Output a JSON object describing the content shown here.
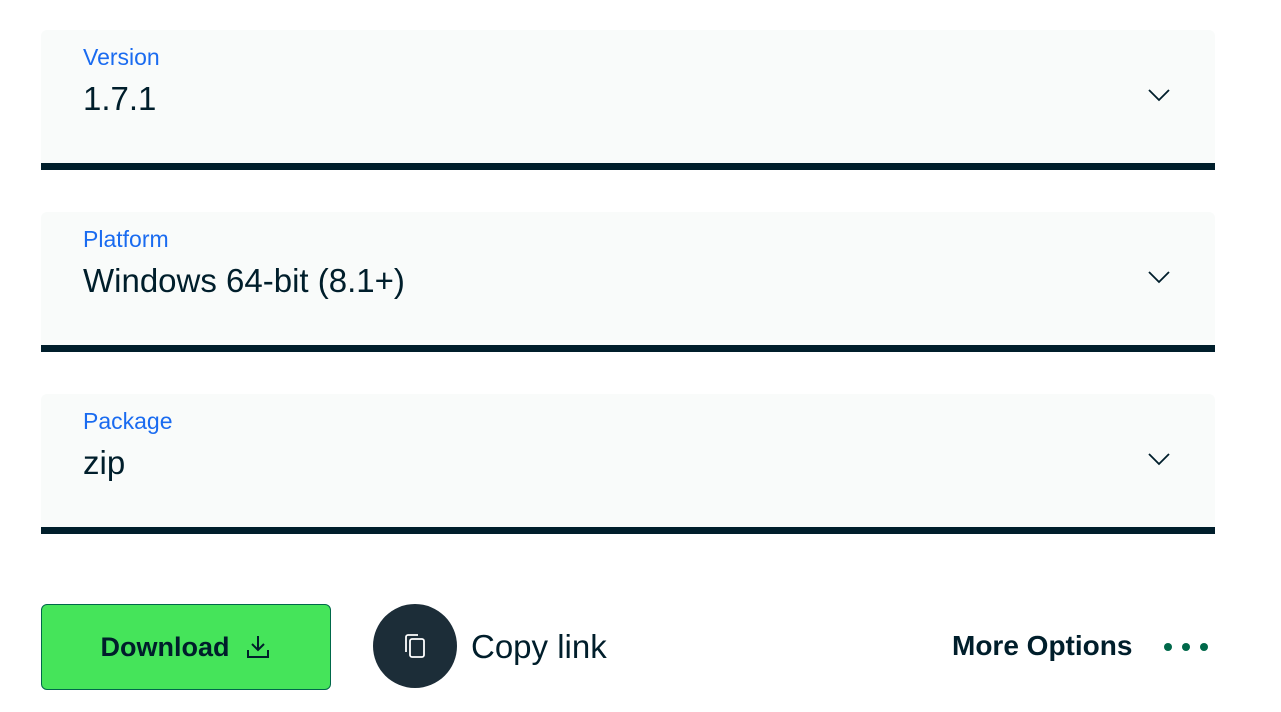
{
  "fields": [
    {
      "label": "Version",
      "value": "1.7.1"
    },
    {
      "label": "Platform",
      "value": "Windows 64-bit (8.1+)"
    },
    {
      "label": "Package",
      "value": "zip"
    }
  ],
  "actions": {
    "download_label": "Download",
    "copy_link_label": "Copy link",
    "more_options_label": "More Options"
  },
  "colors": {
    "accent_label": "#1a6bf0",
    "field_background": "#f9fbfa",
    "underline": "#001e2b",
    "download_button": "#45e45a",
    "copy_circle": "#1c2d38",
    "dots": "#00684a"
  },
  "icons": {
    "dropdown": "chevron-down-icon",
    "download": "download-icon",
    "copy": "copy-icon",
    "more": "more-horizontal-icon"
  }
}
